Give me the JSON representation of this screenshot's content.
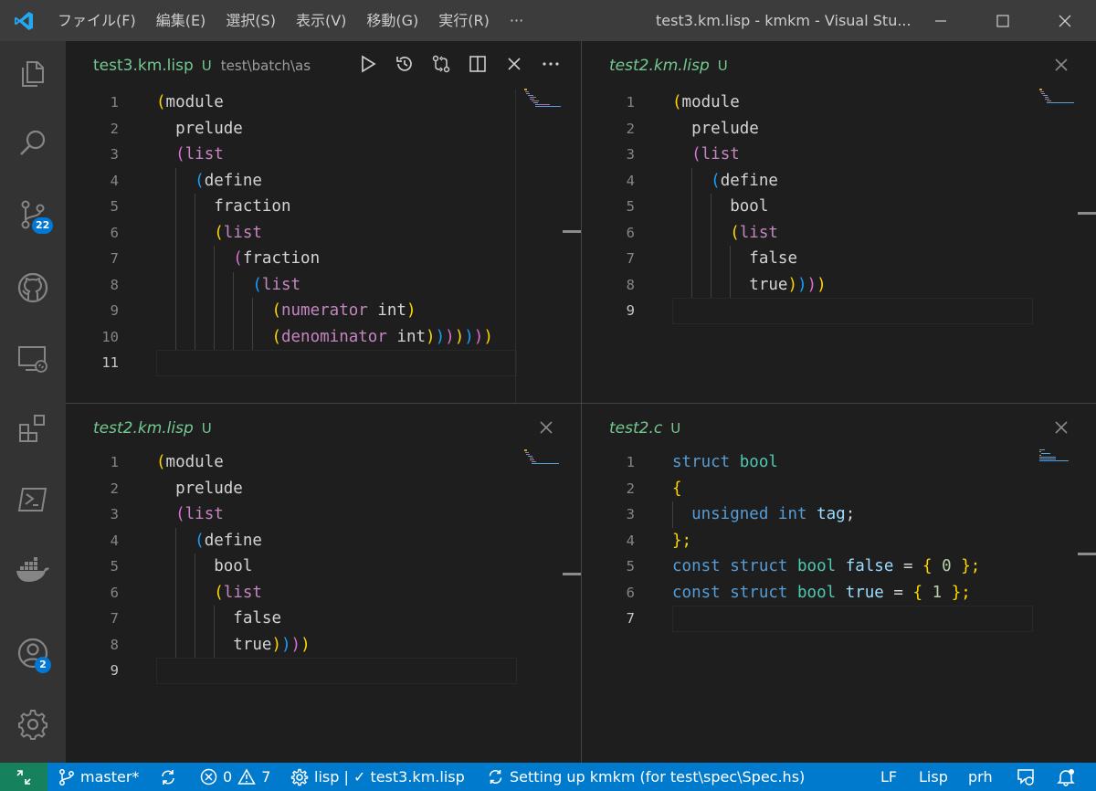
{
  "menu": [
    "ファイル(F)",
    "編集(E)",
    "選択(S)",
    "表示(V)",
    "移動(G)",
    "実行(R)",
    "···"
  ],
  "window_title": "test3.km.lisp - kmkm - Visual Stu...",
  "activity": {
    "source_control_badge": "22",
    "accounts_badge": "2"
  },
  "editors": {
    "top_left": {
      "tab_title": "test3.km.lisp",
      "tab_status": "U",
      "tab_description": "test\\batch\\as",
      "lines": [
        "1",
        "2",
        "3",
        "4",
        "5",
        "6",
        "7",
        "8",
        "9",
        "10",
        "11"
      ]
    },
    "top_right": {
      "tab_title": "test2.km.lisp",
      "tab_status": "U",
      "lines": [
        "1",
        "2",
        "3",
        "4",
        "5",
        "6",
        "7",
        "8",
        "9"
      ]
    },
    "bottom_left": {
      "tab_title": "test2.km.lisp",
      "tab_status": "U",
      "lines": [
        "1",
        "2",
        "3",
        "4",
        "5",
        "6",
        "7",
        "8",
        "9"
      ]
    },
    "bottom_right": {
      "tab_title": "test2.c",
      "tab_status": "U",
      "lines": [
        "1",
        "2",
        "3",
        "4",
        "5",
        "6",
        "7"
      ]
    }
  },
  "tokens": {
    "open": "(",
    "close": ")",
    "module": "module",
    "prelude": "prelude",
    "list": "list",
    "define": "define",
    "fraction": "fraction",
    "numerator": "numerator",
    "denominator": "denominator",
    "int_kw": "int",
    "bool": "bool",
    "false": "false",
    "true": "true",
    "struct": "struct",
    "lbrace": "{",
    "rbrace": "};",
    "unsigned": "unsigned",
    "tag": "tag",
    "semi": ";",
    "const": "const",
    "eq": "=",
    "zero": "0",
    "one": "1",
    "close_brace_semi": "};"
  },
  "statusbar": {
    "branch": "master*",
    "errors": "0",
    "warnings": "7",
    "lisp_task": "lisp | ✓ test3.km.lisp",
    "progress": "Setting up kmkm (for test\\spec\\Spec.hs)",
    "eol": "LF",
    "language": "Lisp",
    "prh": "prh"
  },
  "colors": {
    "accent": "#007acc",
    "remote": "#16825d",
    "untracked": "#73c991",
    "bracket1": "#ffd700",
    "bracket2": "#da70d6",
    "bracket3": "#179fff"
  }
}
